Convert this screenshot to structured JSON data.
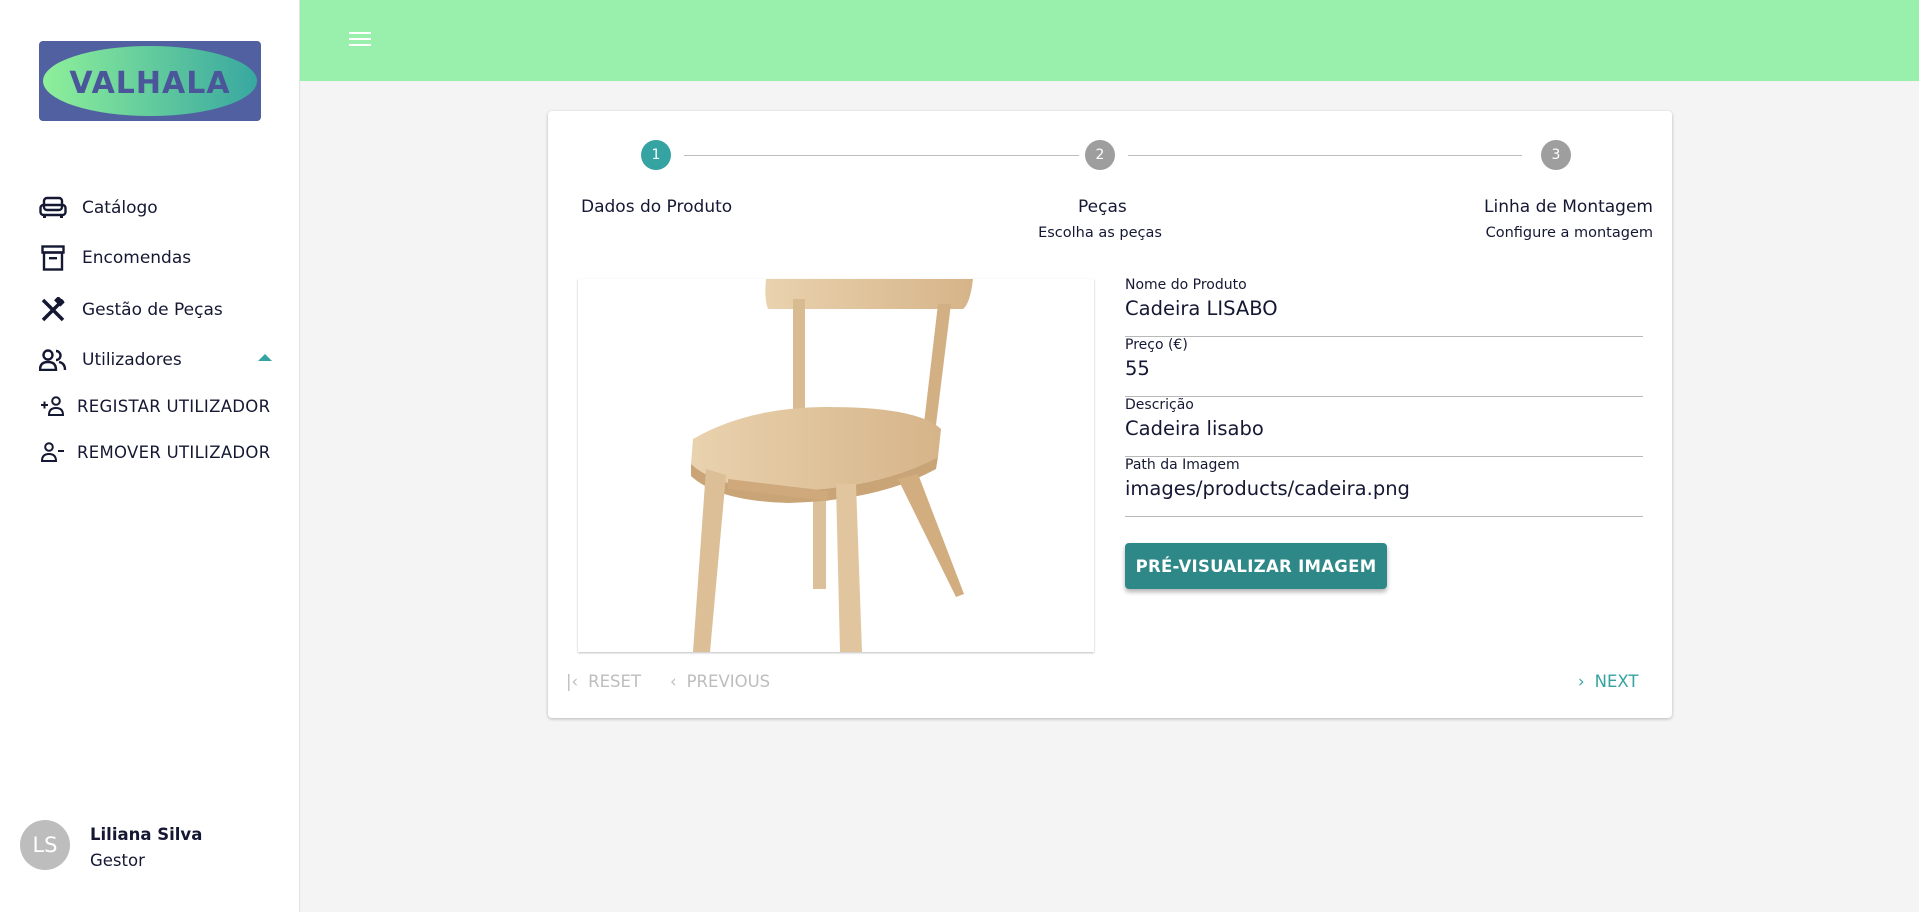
{
  "logo": {
    "text": "VALHALA"
  },
  "header": {
    "menu_icon": "hamburger-icon"
  },
  "sidebar": {
    "items": [
      {
        "label": "Catálogo",
        "icon": "sofa-icon"
      },
      {
        "label": "Encomendas",
        "icon": "archive-icon"
      },
      {
        "label": "Gestão de Peças",
        "icon": "tools-icon"
      },
      {
        "label": "Utilizadores",
        "icon": "group-icon",
        "expanded": true
      }
    ],
    "sub_items": [
      {
        "label": "REGISTAR UTILIZADOR",
        "icon": "person-add-icon"
      },
      {
        "label": "REMOVER UTILIZADOR",
        "icon": "person-remove-icon"
      }
    ],
    "user": {
      "initials": "LS",
      "name": "Liliana Silva",
      "role": "Gestor"
    }
  },
  "stepper": {
    "steps": [
      {
        "number": "1",
        "label": "Dados do Produto",
        "subtitle": "",
        "active": true
      },
      {
        "number": "2",
        "label": "Peças",
        "subtitle": "Escolha as peças",
        "active": false
      },
      {
        "number": "3",
        "label": "Linha de Montagem",
        "subtitle": "Configure a montagem",
        "active": false
      }
    ]
  },
  "form": {
    "fields": [
      {
        "label": "Nome do Produto",
        "value": "Cadeira LISABO"
      },
      {
        "label": "Preço (€)",
        "value": "55"
      },
      {
        "label": "Descrição",
        "value": "Cadeira lisabo"
      },
      {
        "label": "Path da Imagem",
        "value": "images/products/cadeira.png"
      }
    ],
    "preview_button": "PRÉ-VISUALIZAR IMAGEM"
  },
  "footer": {
    "reset": "RESET",
    "previous": "PREVIOUS",
    "next": "NEXT"
  },
  "colors": {
    "accent": "#36a3a3",
    "button": "#2e8887",
    "header": "#99f0ac",
    "inactive_step": "#9e9e9e"
  }
}
